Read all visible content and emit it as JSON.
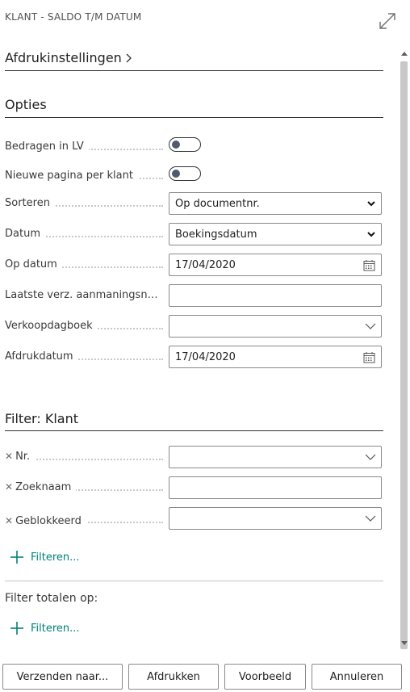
{
  "header": {
    "title": "KLANT - SALDO T/M DATUM"
  },
  "print_settings": {
    "label": "Afdrukinstellingen"
  },
  "options": {
    "title": "Opties",
    "fields": [
      {
        "label": "Bedragen in LV",
        "type": "toggle",
        "value": false
      },
      {
        "label": "Nieuwe pagina per klant",
        "type": "toggle",
        "value": false
      },
      {
        "label": "Sorteren",
        "type": "select",
        "value": "Op documentnr."
      },
      {
        "label": "Datum",
        "type": "select",
        "value": "Boekingsdatum"
      },
      {
        "label": "Op datum",
        "type": "date",
        "value": "17/04/2020"
      },
      {
        "label": "Laatste verz. aanmaningsni...",
        "type": "text",
        "value": ""
      },
      {
        "label": "Verkoopdagboek",
        "type": "lookup",
        "value": ""
      },
      {
        "label": "Afdrukdatum",
        "type": "date",
        "value": "17/04/2020"
      }
    ]
  },
  "filter": {
    "title": "Filter: Klant",
    "fields": [
      {
        "label": "Nr.",
        "value": ""
      },
      {
        "label": "Zoeknaam",
        "value": ""
      },
      {
        "label": "Geblokkeerd",
        "value": ""
      }
    ],
    "add_label": "Filteren..."
  },
  "totals": {
    "label": "Filter totalen op:",
    "add_label": "Filteren..."
  },
  "footer": {
    "send_label": "Verzenden naar...",
    "print_label": "Afdrukken",
    "preview_label": "Voorbeeld",
    "cancel_label": "Annuleren"
  },
  "colors": {
    "accent": "#00817a",
    "border": "#8a8a8a",
    "toggle_knob": "#505a6b"
  }
}
